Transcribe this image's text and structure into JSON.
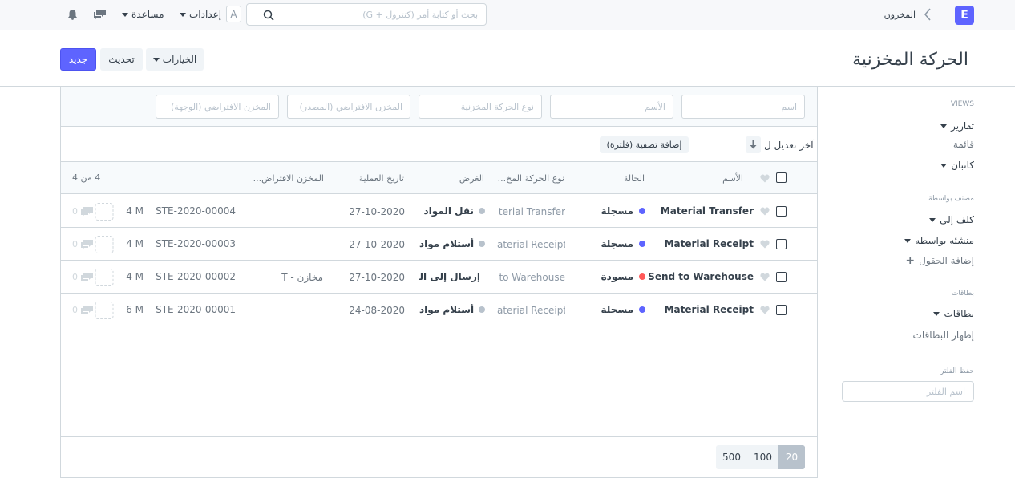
{
  "navbar": {
    "logo_letter": "E",
    "breadcrumb": "المخزون",
    "search_placeholder": "بحث أو كتابة أمر (كنترول + G)",
    "avatar_letter": "A",
    "settings_label": "إعدادات",
    "help_label": "مساعدة"
  },
  "page": {
    "title": "الحركة المخزنية",
    "new_label": "جديد",
    "refresh_label": "تحديث",
    "options_label": "الخيارات"
  },
  "sidebar": {
    "views_title": "VIEWS",
    "reports": "تقارير",
    "list": "قائمة",
    "kanban": "كانبان",
    "grouped_by_title": "مصنف بواسطة",
    "assigned_to": "كلف إلى",
    "created_by": "منشئه بواسطه",
    "add_fields": "إضافة الحقول",
    "tags_title": "بطاقات",
    "tags": "بطاقات",
    "show_tags": "إظهار البطاقات",
    "save_filter_title": "حفظ الفلتر",
    "filter_name_placeholder": "اسم الفلتر"
  },
  "filters": {
    "placeholders": [
      "اسم",
      "الأسم",
      "نوع الحركة المخزنية",
      "المخزن الافتراضي (المصدر)",
      "المخزن الافتراضي (الوجهة)"
    ],
    "sort_label": "آخر تعديل ل",
    "add_filter": "إضافة تصفية (فلترة)"
  },
  "list": {
    "headers": {
      "name": "الأسم",
      "status": "الحالة",
      "type": "نوع الحركة المخ...",
      "purpose": "الغرض",
      "date": "تاريخ العملية",
      "warehouse": "المخزن الافتراض..."
    },
    "count": "4 من 4",
    "rows": [
      {
        "name": "Material Transfer",
        "status": "مسجلة",
        "status_color": "#5e64ff",
        "type": "terial Transfer",
        "purpose": "نقل المواد",
        "date": "27-10-2020",
        "warehouse": "",
        "id": "STE-2020-00004",
        "modified": "4 M",
        "comments": "0"
      },
      {
        "name": "Material Receipt",
        "status": "مسجلة",
        "status_color": "#5e64ff",
        "type": "aterial Receipt",
        "purpose": "أستلام مواد",
        "date": "27-10-2020",
        "warehouse": "",
        "id": "STE-2020-00003",
        "modified": "4 M",
        "comments": "0"
      },
      {
        "name": "Send to Warehouse",
        "status": "مسودة",
        "status_color": "#ff5858",
        "type": "to Warehouse",
        "purpose": "إرسال إلى الـ",
        "date": "27-10-2020",
        "warehouse": "مخازن - T",
        "id": "STE-2020-00002",
        "modified": "4 M",
        "comments": "0"
      },
      {
        "name": "Material Receipt",
        "status": "مسجلة",
        "status_color": "#5e64ff",
        "type": "aterial Receipt",
        "purpose": "أستلام مواد",
        "date": "24-08-2020",
        "warehouse": "",
        "id": "STE-2020-00001",
        "modified": "6 M",
        "comments": "0"
      }
    ]
  },
  "paging": {
    "sizes": [
      "20",
      "100",
      "500"
    ]
  }
}
